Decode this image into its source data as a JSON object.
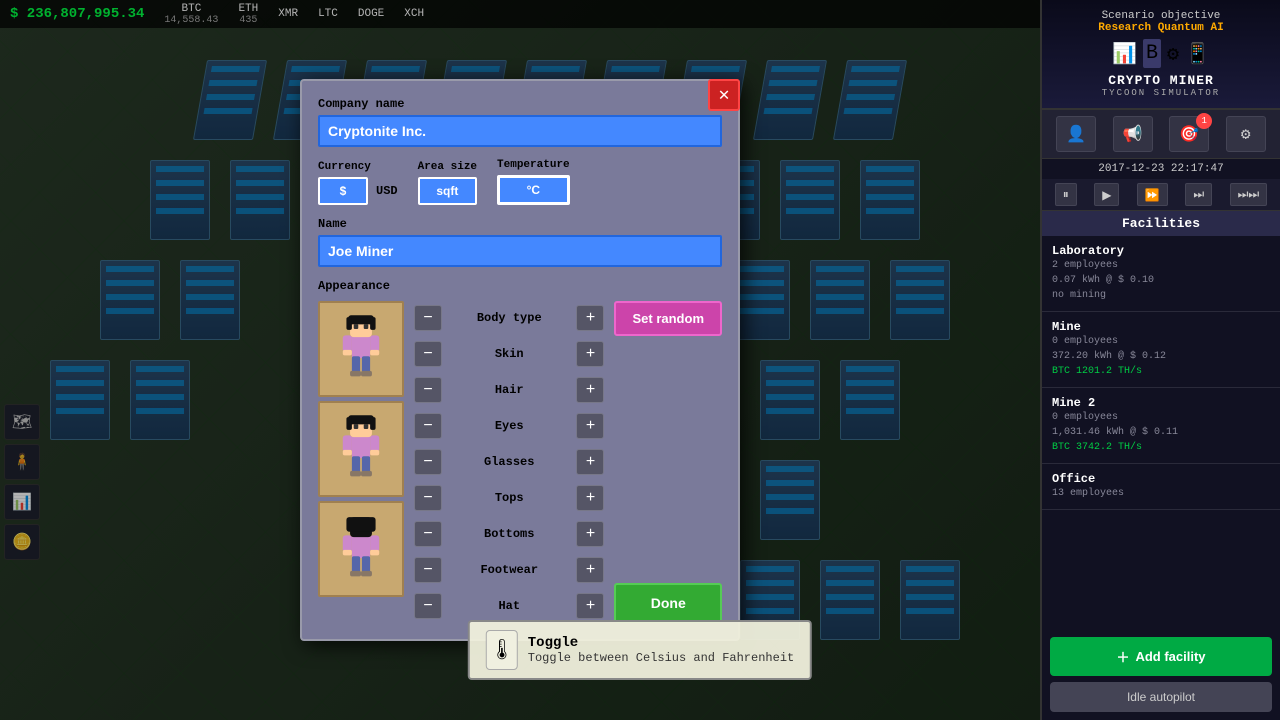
{
  "topbar": {
    "money": "$ 236,807,995.34",
    "cryptos": [
      {
        "name": "BTC",
        "value": "14,558.43"
      },
      {
        "name": "ETH",
        "value": "435"
      },
      {
        "name": "XMR",
        "value": ""
      },
      {
        "name": "LTC",
        "value": ""
      },
      {
        "name": "DOGE",
        "value": ""
      },
      {
        "name": "XCH",
        "value": ""
      }
    ]
  },
  "right_panel": {
    "scenario_label": "Scenario objective",
    "objective": "Research Quantum AI",
    "game_title": "CRYPTO MINER",
    "game_subtitle": "TYCOON SIMULATOR",
    "datetime": "2017-12-23 22:17:47",
    "facilities_header": "Facilities",
    "facilities": [
      {
        "name": "Laboratory",
        "employees": "2 employees",
        "detail1": "0.07 kWh @ $ 0.10",
        "detail2": "no mining"
      },
      {
        "name": "Mine",
        "employees": "0 employees",
        "detail1": "372.20 kWh @ $ 0.12",
        "detail2": "BTC 1201.2 TH/s"
      },
      {
        "name": "Mine 2",
        "employees": "0 employees",
        "detail1": "1,031.46 kWh @ $ 0.11",
        "detail2": "BTC 3742.2 TH/s"
      },
      {
        "name": "Office",
        "employees": "13 employees",
        "detail1": "",
        "detail2": ""
      }
    ],
    "add_facility_label": "Add facility",
    "idle_autopilot_label": "Idle autopilot"
  },
  "dialog": {
    "company_name_label": "Company name",
    "company_name_value": "Cryptonite Inc.",
    "currency_label": "Currency",
    "currency_symbol": "$",
    "currency_name": "USD",
    "area_size_label": "Area size",
    "area_size_value": "sqft",
    "temperature_label": "Temperature",
    "temperature_value": "°C",
    "name_label": "Name",
    "name_value": "Joe Miner",
    "appearance_label": "Appearance",
    "appearance_controls": [
      {
        "label": "Body type"
      },
      {
        "label": "Skin"
      },
      {
        "label": "Hair"
      },
      {
        "label": "Eyes"
      },
      {
        "label": "Glasses"
      },
      {
        "label": "Tops"
      },
      {
        "label": "Bottoms"
      },
      {
        "label": "Footwear"
      },
      {
        "label": "Hat"
      }
    ],
    "set_random_label": "Set random",
    "done_label": "Done"
  },
  "toggle_tooltip": {
    "title": "Toggle",
    "description": "Toggle between Celsius and Fahrenheit",
    "icon": "🌡"
  },
  "icons": {
    "close": "✕",
    "minus": "−",
    "plus": "+",
    "pause": "⏸",
    "play": "▶",
    "fast": "⏩",
    "faster": "⏭",
    "fastest": "⏭",
    "notification_count": "1"
  }
}
